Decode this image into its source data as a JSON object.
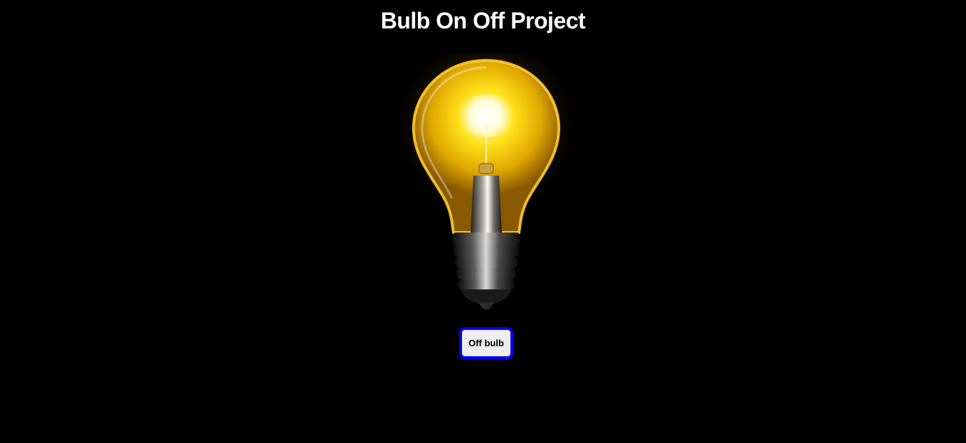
{
  "header": {
    "title": "Bulb On Off Project"
  },
  "bulb": {
    "icon": "light-bulb-icon",
    "state": "on",
    "glow_color": "#ffd21a",
    "halo_color": "#ffb300"
  },
  "controls": {
    "toggle_label": "Off bulb",
    "toggle_border_color": "#0000ff",
    "toggle_background": "#efefef"
  },
  "page": {
    "background": "#000000",
    "title_color": "#ffffff"
  }
}
